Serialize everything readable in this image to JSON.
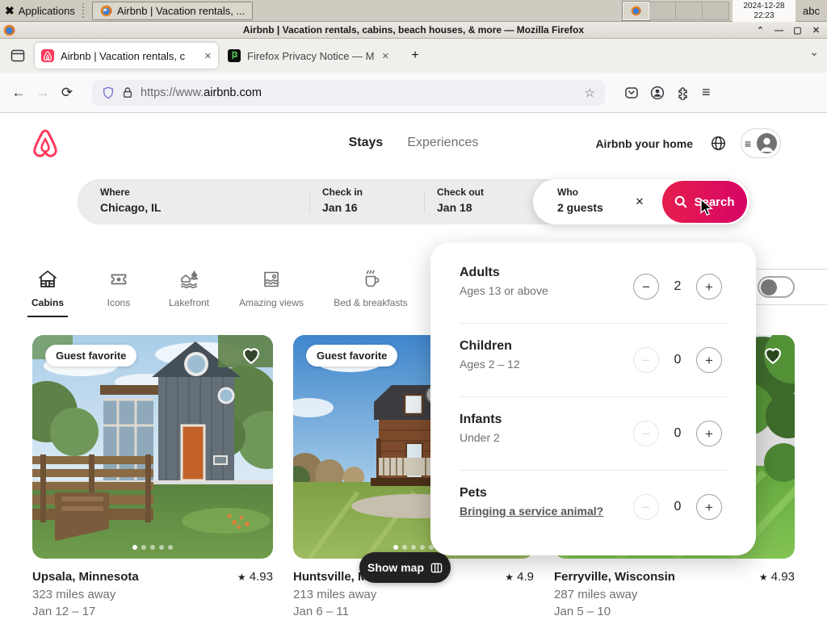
{
  "icons": {
    "star": "★",
    "bookmark_star": "☆",
    "close": "✕",
    "plus": "+",
    "minus": "−",
    "chevron_down": "⌄",
    "hamburger": "≡",
    "back": "←",
    "forward": "→",
    "reload": "⟳",
    "window_shade": "⌃",
    "window_min": "—",
    "window_max": "▢",
    "window_close": "✕",
    "apps": "✖",
    "moz_favicon": "|3"
  },
  "taskbar": {
    "applications_label": "Applications",
    "window_button_label": "Airbnb | Vacation rentals, ...",
    "clock_date": "2024-12-28",
    "clock_time": "22:23",
    "user": "abc"
  },
  "titlebar": {
    "title": "Airbnb | Vacation rentals, cabins, beach houses, & more — Mozilla Firefox"
  },
  "tabbar": {
    "tabs": [
      {
        "title": "Airbnb | Vacation rentals, c"
      },
      {
        "title": "Firefox Privacy Notice — M"
      }
    ]
  },
  "urlbar": {
    "url_prefix": "https://www.",
    "url_domain": "airbnb.com"
  },
  "header": {
    "stays": "Stays",
    "experiences": "Experiences",
    "host_link": "Airbnb your home"
  },
  "search": {
    "where_label": "Where",
    "where_value": "Chicago, IL",
    "checkin_label": "Check in",
    "checkin_value": "Jan 16",
    "checkout_label": "Check out",
    "checkout_value": "Jan 18",
    "who_label": "Who",
    "who_value": "2 guests",
    "button_label": "Search"
  },
  "categories": {
    "items": [
      {
        "label": "Cabins",
        "active": true
      },
      {
        "label": "Icons",
        "active": false
      },
      {
        "label": "Lakefront",
        "active": false
      },
      {
        "label": "Amazing views",
        "active": false
      },
      {
        "label": "Bed & breakfasts",
        "active": false
      }
    ]
  },
  "guest_picker": {
    "rows": [
      {
        "title": "Adults",
        "subtitle": "Ages 13 or above",
        "value": "2"
      },
      {
        "title": "Children",
        "subtitle": "Ages 2 – 12",
        "value": "0"
      },
      {
        "title": "Infants",
        "subtitle": "Under 2",
        "value": "0"
      },
      {
        "title": "Pets",
        "subtitle": "Bringing a service animal?",
        "value": "0"
      }
    ]
  },
  "listings": [
    {
      "badge": "Guest favorite",
      "title": "Upsala, Minnesota",
      "rating": "4.93",
      "distance": "323 miles away",
      "dates": "Jan 12 – 17"
    },
    {
      "badge": "Guest favorite",
      "title": "Huntsville, M",
      "rating": "4.9",
      "distance": "213 miles away",
      "dates": "Jan 6 – 11"
    },
    {
      "badge": "",
      "title": "Ferryville, Wisconsin",
      "rating": "4.93",
      "distance": "287 miles away",
      "dates": "Jan 5 – 10"
    }
  ],
  "map_button": {
    "label": "Show map"
  },
  "colors": {
    "brand": "#FF385C",
    "search_gradient_start": "#E61E4D",
    "search_gradient_end": "#D70466",
    "text_dark": "#222222",
    "text_gray": "#717171"
  }
}
